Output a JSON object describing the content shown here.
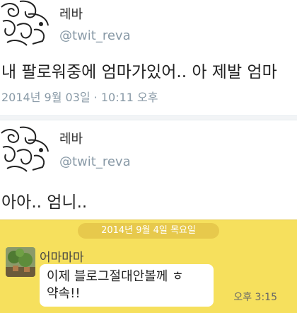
{
  "tweets": [
    {
      "author_name": "레바",
      "handle": "@twit_reva",
      "text": "내 팔로워중에 엄마가있어.. 아 제발 엄마",
      "timestamp": "2014년 9월 03일 · 10:11 오후"
    },
    {
      "author_name": "레바",
      "handle": "@twit_reva",
      "text": "아아.. 엄니.."
    }
  ],
  "chat": {
    "date_label": "2014년 9월 4일 목요일",
    "sender": "어마마마",
    "message_lines": [
      "이제 블로그절대안볼께 ㅎ",
      "약속!!"
    ],
    "time": "오후 3:15",
    "background_color": "#f6e05d"
  }
}
